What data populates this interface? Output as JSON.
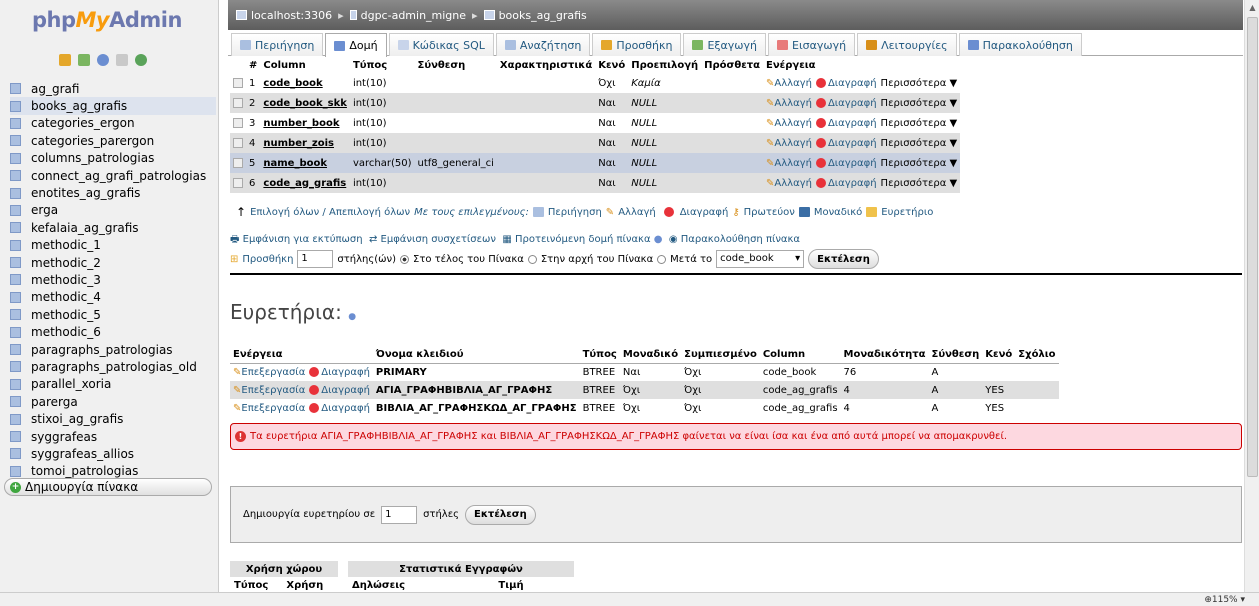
{
  "sidebar": {
    "logo": {
      "php": "php",
      "my": "My",
      "admin": "Admin"
    },
    "tables": [
      "ag_grafi",
      "books_ag_grafis",
      "categories_ergon",
      "categories_parergon",
      "columns_patrologias",
      "connect_ag_grafi_patrologias",
      "enotites_ag_grafis",
      "erga",
      "kefalaia_ag_grafis",
      "methodic_1",
      "methodic_2",
      "methodic_3",
      "methodic_4",
      "methodic_5",
      "methodic_6",
      "paragraphs_patrologias",
      "paragraphs_patrologias_old",
      "parallel_xoria",
      "parerga",
      "stixoi_ag_grafis",
      "syggrafeas",
      "syggrafeas_allios",
      "tomoi_patrologias"
    ],
    "active_table": "books_ag_grafis",
    "create_table": "Δημιουργία πίνακα"
  },
  "breadcrumb": {
    "server": "localhost:3306",
    "database": "dgpc-admin_migne",
    "table": "books_ag_grafis"
  },
  "tabs": [
    "Περιήγηση",
    "Δομή",
    "Κώδικας SQL",
    "Αναζήτηση",
    "Προσθήκη",
    "Εξαγωγή",
    "Εισαγωγή",
    "Λειτουργίες",
    "Παρακολούθηση"
  ],
  "structure": {
    "headers": [
      "#",
      "Column",
      "Τύπος",
      "Σύνθεση",
      "Χαρακτηριστικά",
      "Κενό",
      "Προεπιλογή",
      "Πρόσθετα",
      "Ενέργεια"
    ],
    "rows": [
      {
        "num": "1",
        "name": "code_book",
        "type": "int(10)",
        "collation": "",
        "attributes": "",
        "null": "Όχι",
        "default": "Καμία",
        "extra": ""
      },
      {
        "num": "2",
        "name": "code_book_skk",
        "type": "int(10)",
        "collation": "",
        "attributes": "",
        "null": "Ναι",
        "default": "NULL",
        "extra": ""
      },
      {
        "num": "3",
        "name": "number_book",
        "type": "int(10)",
        "collation": "",
        "attributes": "",
        "null": "Ναι",
        "default": "NULL",
        "extra": ""
      },
      {
        "num": "4",
        "name": "number_zois",
        "type": "int(10)",
        "collation": "",
        "attributes": "",
        "null": "Ναι",
        "default": "NULL",
        "extra": ""
      },
      {
        "num": "5",
        "name": "name_book",
        "type": "varchar(50)",
        "collation": "utf8_general_ci",
        "attributes": "",
        "null": "Ναι",
        "default": "NULL",
        "extra": ""
      },
      {
        "num": "6",
        "name": "code_ag_grafis",
        "type": "int(10)",
        "collation": "",
        "attributes": "",
        "null": "Ναι",
        "default": "NULL",
        "extra": ""
      }
    ],
    "action_change": "Αλλαγή",
    "action_drop": "Διαγραφή",
    "action_more": "Περισσότερα"
  },
  "bulk": {
    "check_all": "Επιλογή όλων / Απεπιλογή όλων",
    "with_selected": "Με τους επιλεγμένους:",
    "browse": "Περιήγηση",
    "change": "Αλλαγή",
    "drop": "Διαγραφή",
    "primary": "Πρωτεύον",
    "unique": "Μοναδικό",
    "index": "Ευρετήριο"
  },
  "links": {
    "print": "Εμφάνιση για εκτύπωση",
    "relation": "Εμφάνιση συσχετίσεων",
    "propose": "Προτεινόμενη δομή πίνακα",
    "track": "Παρακολούθηση πίνακα"
  },
  "add_column": {
    "label": "Προσθήκη",
    "count": "1",
    "columns_text": "στήλης(ών)",
    "end": "Στο τέλος του Πίνακα",
    "start": "Στην αρχή του Πίνακα",
    "after": "Μετά το",
    "after_value": "code_book",
    "go": "Εκτέλεση"
  },
  "indexes": {
    "title": "Ευρετήρια:",
    "headers": [
      "Ενέργεια",
      "Όνομα κλειδιού",
      "Τύπος",
      "Μοναδικό",
      "Συμπιεσμένο",
      "Column",
      "Μοναδικότητα",
      "Σύνθεση",
      "Κενό",
      "Σχόλιο"
    ],
    "edit": "Επεξεργασία",
    "drop": "Διαγραφή",
    "rows": [
      {
        "key": "PRIMARY",
        "type": "BTREE",
        "unique": "Ναι",
        "packed": "Όχι",
        "column": "code_book",
        "cardinality": "76",
        "collation": "A",
        "null": "",
        "comment": ""
      },
      {
        "key": "ΑΓΙΑ_ΓΡΑΦΗΒΙΒΛΙΑ_ΑΓ_ΓΡΑΦΗΣ",
        "type": "BTREE",
        "unique": "Όχι",
        "packed": "Όχι",
        "column": "code_ag_grafis",
        "cardinality": "4",
        "collation": "A",
        "null": "YES",
        "comment": ""
      },
      {
        "key": "ΒΙΒΛΙΑ_ΑΓ_ΓΡΑΦΗΣΚΩΔ_ΑΓ_ΓΡΑΦΗΣ",
        "type": "BTREE",
        "unique": "Όχι",
        "packed": "Όχι",
        "column": "code_ag_grafis",
        "cardinality": "4",
        "collation": "A",
        "null": "YES",
        "comment": ""
      }
    ]
  },
  "warning": "Τα ευρετήρια ΑΓΙΑ_ΓΡΑΦΗΒΙΒΛΙΑ_ΑΓ_ΓΡΑΦΗΣ και ΒΙΒΛΙΑ_ΑΓ_ΓΡΑΦΗΣΚΩΔ_ΑΓ_ΓΡΑΦΗΣ φαίνεται να είναι ίσα και ένα από αυτά μπορεί να απομακρυνθεί.",
  "create_index": {
    "label": "Δημιουργία ευρετηρίου σε",
    "count": "1",
    "columns": "στήλες",
    "go": "Εκτέλεση"
  },
  "space": {
    "title": "Χρήση χώρου",
    "col1": "Τύπος",
    "col2": "Χρήση"
  },
  "stats": {
    "title": "Στατιστικά Εγγραφών",
    "col1": "Δηλώσεις",
    "col2": "Τιμή"
  },
  "zoom": "115%",
  "colors": {
    "link": "#235a81",
    "warning_bg": "#fdd8e0",
    "warning_text": "#cc0000",
    "logo_orange": "#f89c0e",
    "logo_blue": "#6c78af"
  }
}
